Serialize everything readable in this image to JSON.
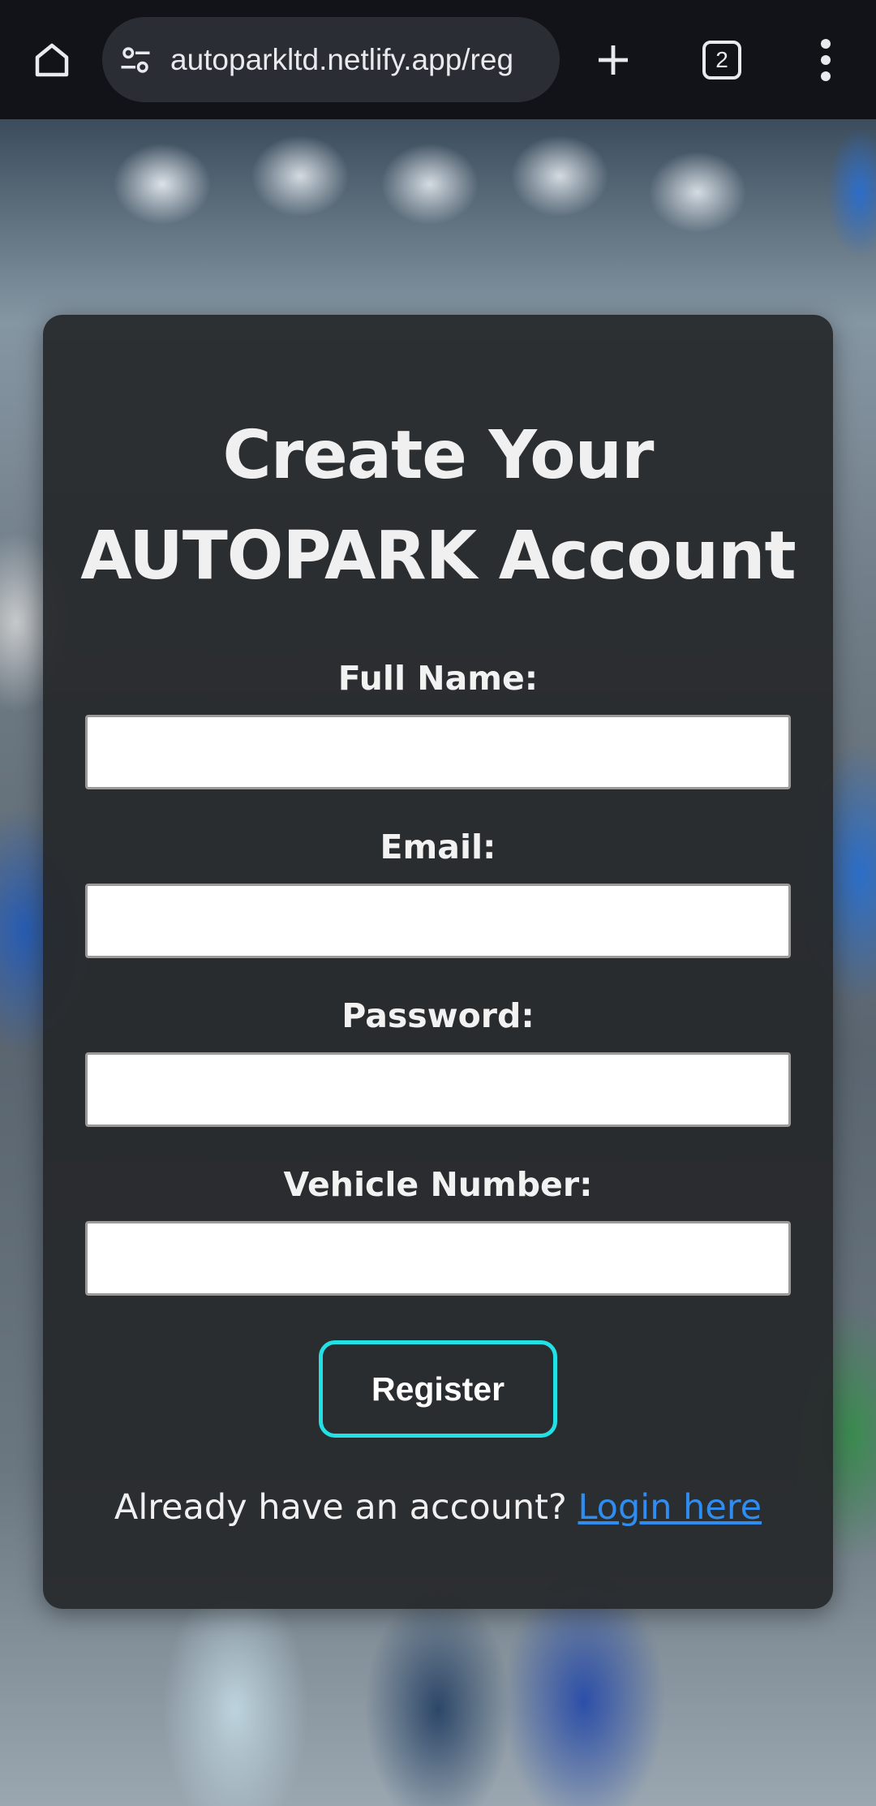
{
  "browser": {
    "url": "autoparkltd.netlify.app/reg",
    "tab_count": "2",
    "icons": {
      "home": "home-icon",
      "site_settings": "tune-icon",
      "new_tab": "plus-icon",
      "menu": "more-vert-icon"
    }
  },
  "form": {
    "title_line1": "Create Your",
    "title_line2": "AUTOPARK Account",
    "fields": [
      {
        "label": "Full Name:",
        "value": ""
      },
      {
        "label": "Email:",
        "value": ""
      },
      {
        "label": "Password:",
        "value": ""
      },
      {
        "label": "Vehicle Number:",
        "value": ""
      }
    ],
    "register_label": "Register",
    "footer_text": "Already have an account?",
    "login_link": "Login here"
  },
  "colors": {
    "accent_border": "#22e0e4",
    "link": "#2f8cf0",
    "card_bg": "#26282a",
    "browser_bar": "#111318"
  }
}
